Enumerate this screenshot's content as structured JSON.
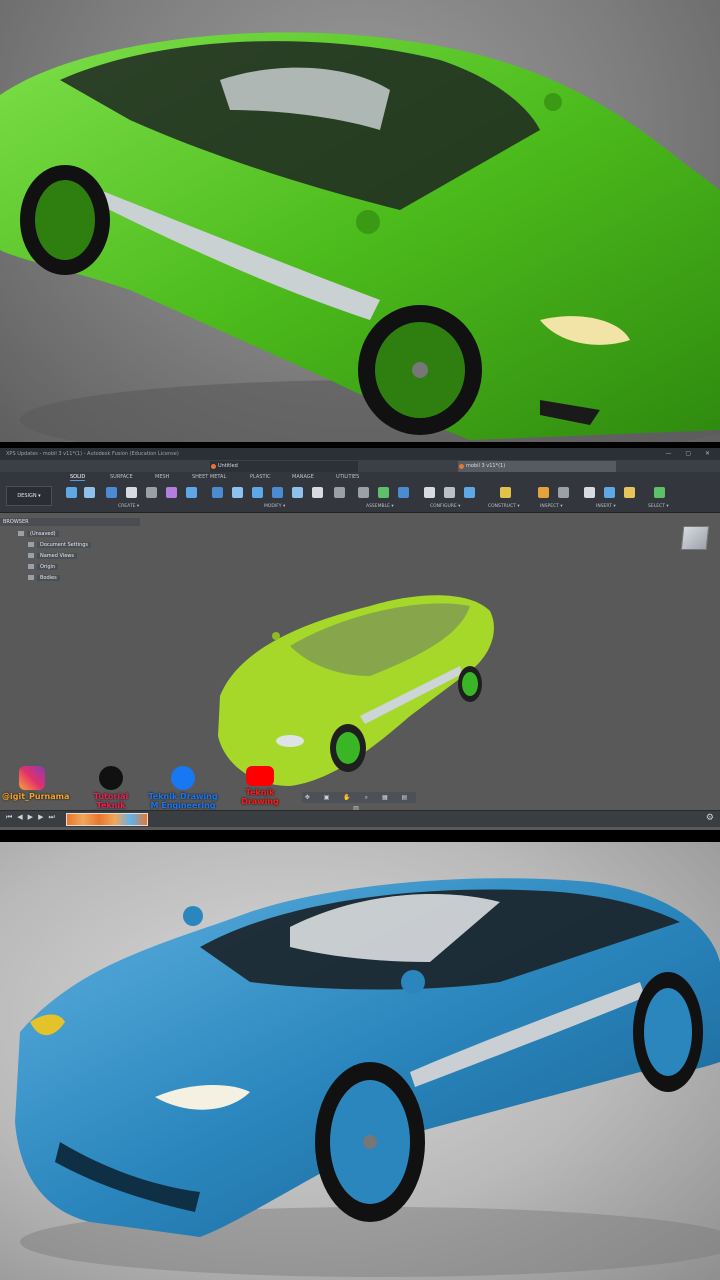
{
  "window": {
    "title": "XPS Updates - mobil 3 v11*(1) - Autodesk Fusion (Education License)",
    "controls": "— ▢ ✕"
  },
  "tabs": [
    {
      "label": "Untitled"
    },
    {
      "label": "mobil 3 v11*(1)"
    }
  ],
  "ribbon": {
    "workspace": "DESIGN ▾",
    "tabs": [
      "SOLID",
      "SURFACE",
      "MESH",
      "SHEET METAL",
      "PLASTIC",
      "MANAGE",
      "UTILITIES"
    ],
    "groups": [
      "CREATE ▾",
      "MODIFY ▾",
      "ASSEMBLE ▾",
      "CONFIGURE ▾",
      "CONSTRUCT ▾",
      "INSPECT ▾",
      "INSERT ▾",
      "SELECT ▾"
    ]
  },
  "browser": {
    "header": "BROWSER",
    "items": [
      "(Unsaved)",
      "Document Settings",
      "Named Views",
      "Origin",
      "Bodies"
    ]
  },
  "social": [
    {
      "icon": "instagram-icon",
      "label": "@igit_Purnama"
    },
    {
      "icon": "tiktok-icon",
      "label": "Tutorial Teknik Drawing"
    },
    {
      "icon": "facebook-icon",
      "label": "Teknik Drawing M Engineering"
    },
    {
      "icon": "youtube-icon",
      "label": "Teknik Drawing"
    }
  ],
  "colors": {
    "top_car": "#4cbb1c",
    "app_car": "#a6d82a",
    "bottom_car": "#2a86bd",
    "accent": "#e8772e"
  }
}
